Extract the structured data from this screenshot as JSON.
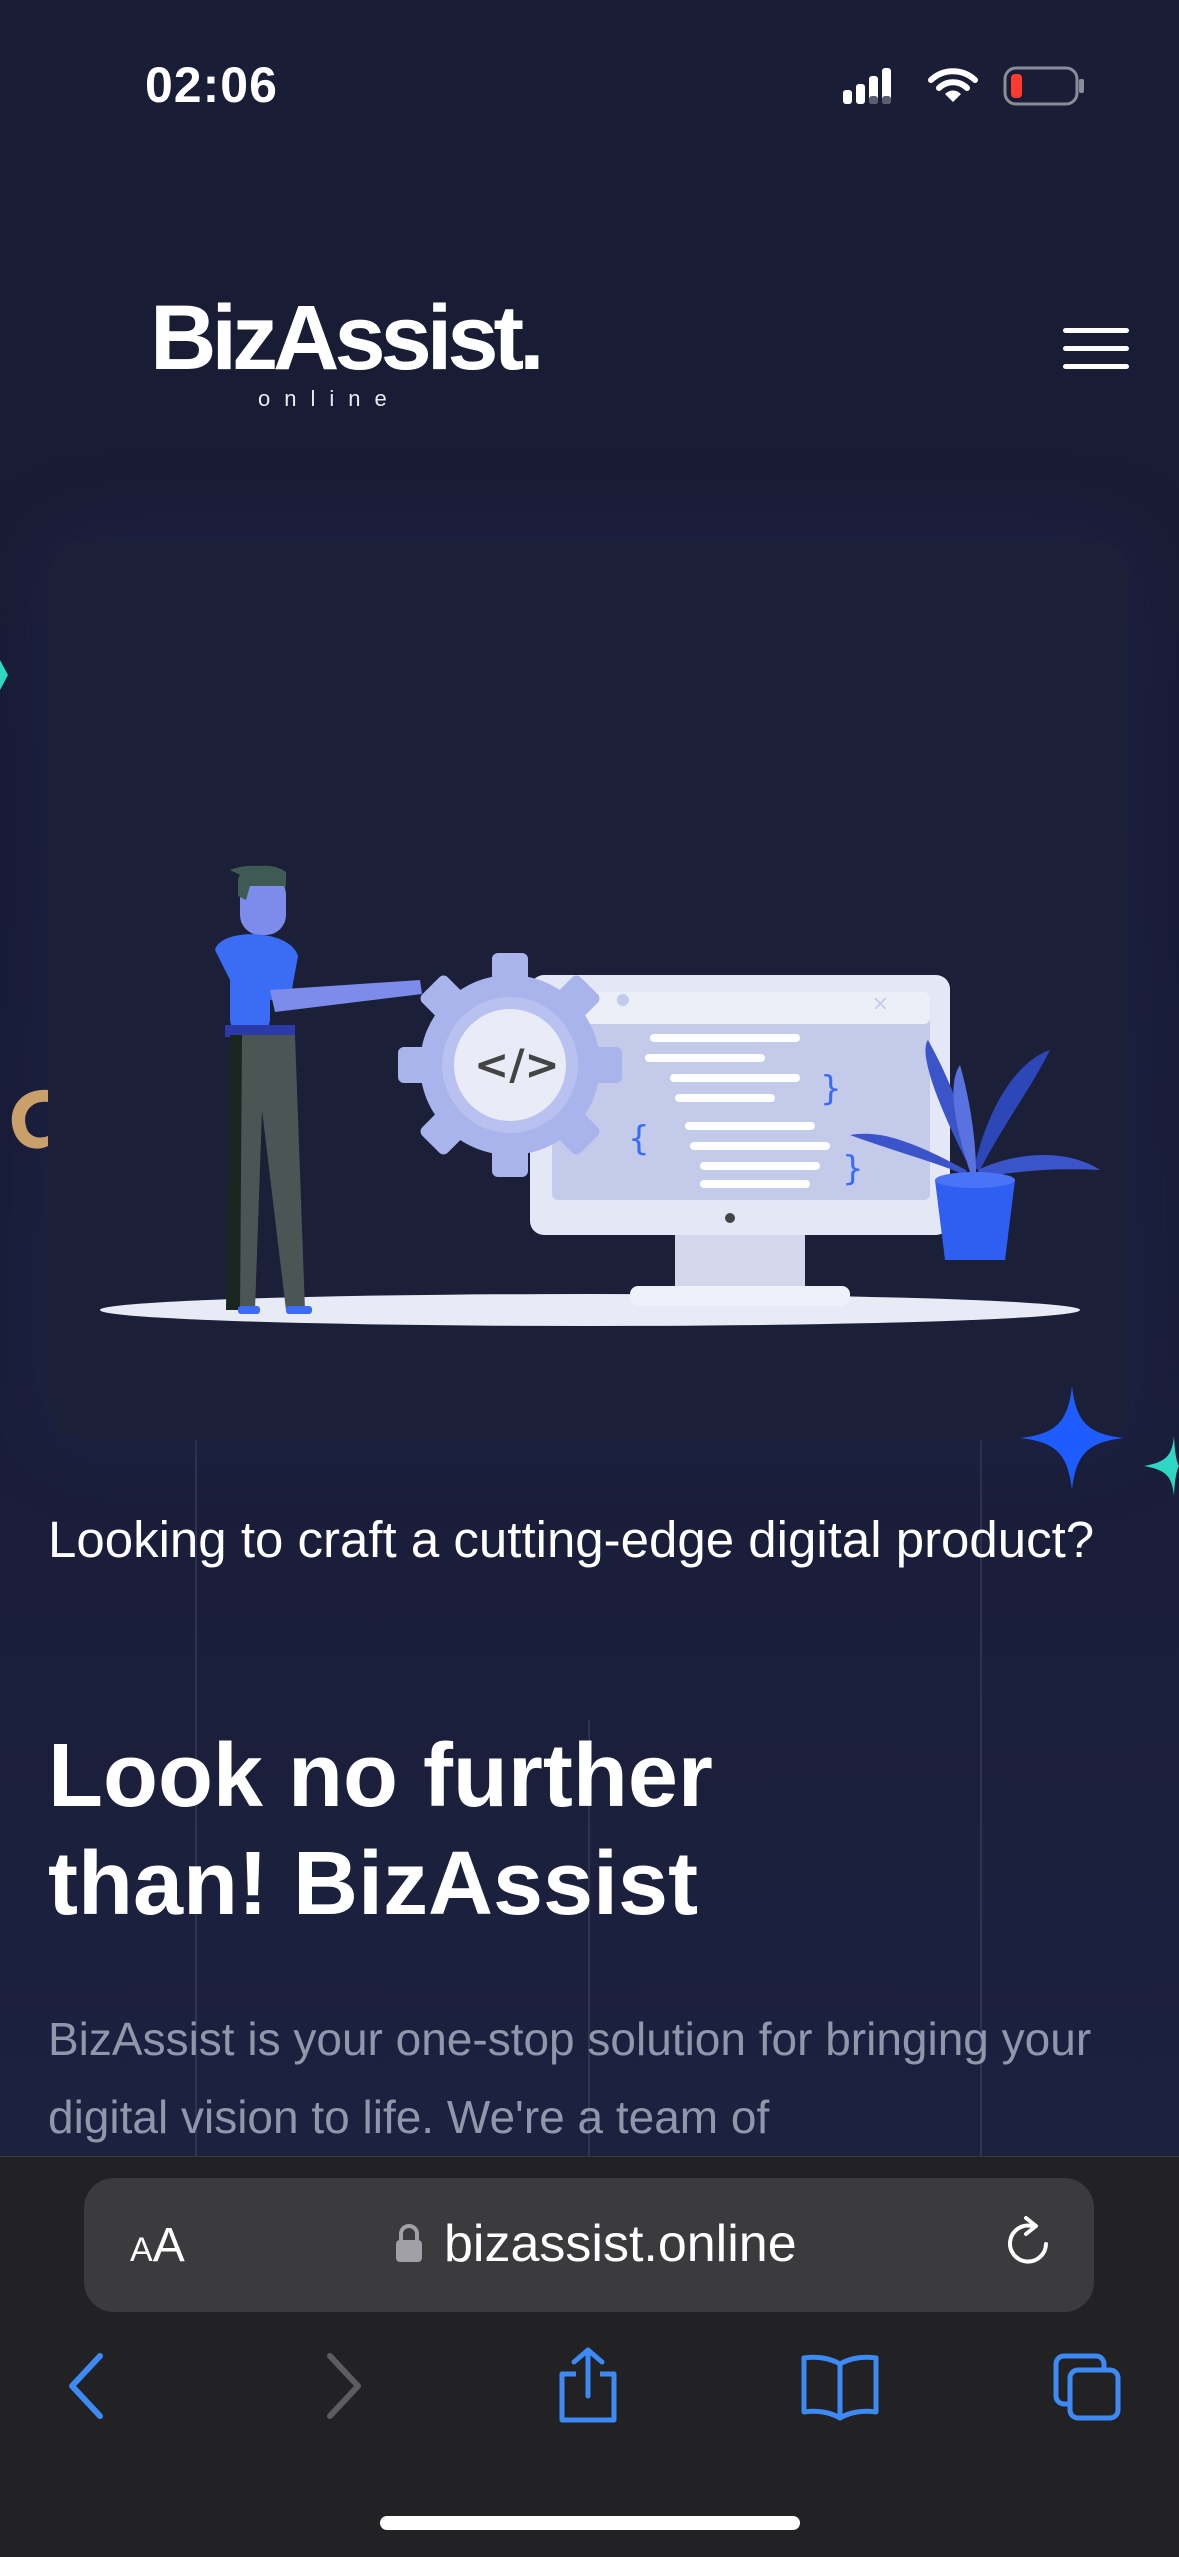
{
  "status_bar": {
    "time": "02:06",
    "icons": [
      "cellular-signal-icon",
      "wifi-icon",
      "battery-low-icon"
    ]
  },
  "header": {
    "logo_text": "BizAssist",
    "logo_dot": ".",
    "logo_subtitle": "online",
    "menu_icon": "hamburger-menu-icon"
  },
  "hero": {
    "illustration": "developer-with-gear-and-monitor-illustration",
    "tagline": "Looking to craft a cutting-edge digital product?",
    "headline_line1": "Look no further",
    "headline_line2": "than! BizAssist",
    "body": "BizAssist is your one-stop solution for bringing your digital vision to life. We're a team of"
  },
  "browser": {
    "text_size_label_small": "A",
    "text_size_label_large": "A",
    "url": "bizassist.online",
    "toolbar": [
      "back-icon",
      "forward-icon",
      "share-icon",
      "bookmarks-icon",
      "tabs-icon"
    ]
  },
  "colors": {
    "background": "#181c33",
    "accent_blue": "#3b6cf6",
    "illustration_lavender": "#a9b3ec",
    "teal": "#2fd6c4",
    "safari_blue": "#3d8af7",
    "muted_text": "#9296ab"
  }
}
